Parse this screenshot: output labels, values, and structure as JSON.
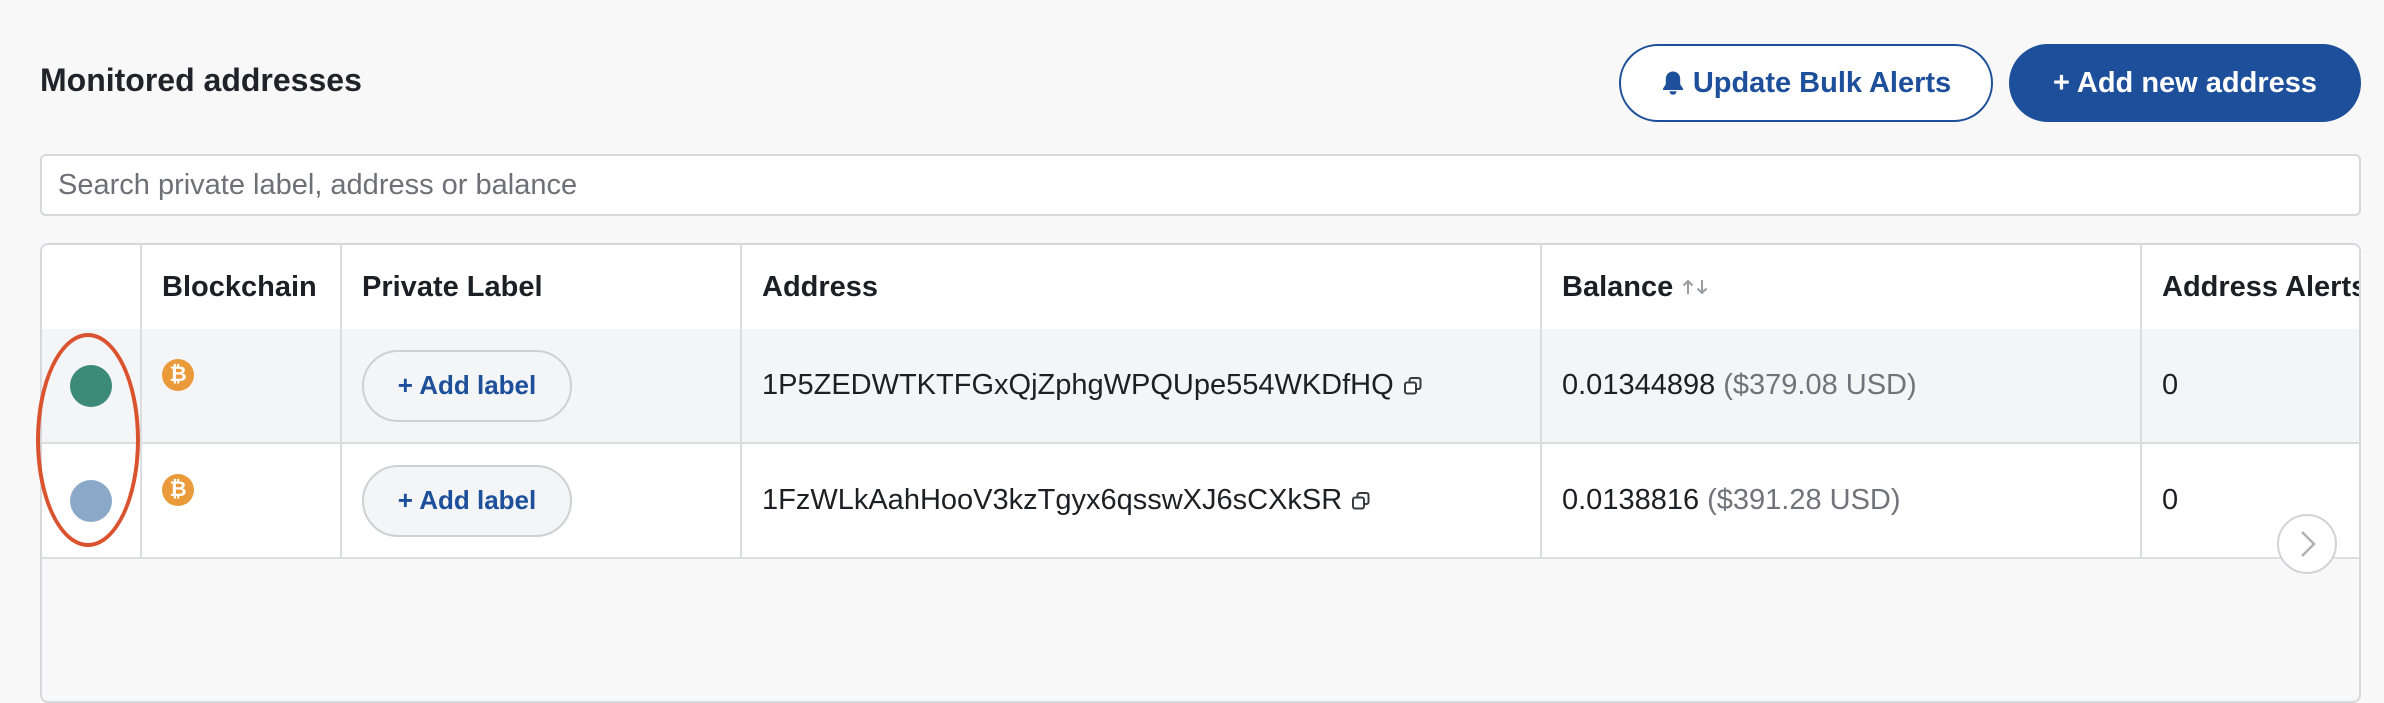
{
  "page": {
    "title": "Monitored addresses",
    "update_alerts_label": "Update Bulk Alerts",
    "add_address_label": "+ Add new address",
    "search_placeholder": "Search private label, address or balance"
  },
  "colors": {
    "accent": "#1d4f9a",
    "bitcoin": "#eb9a3a",
    "annotation": "#d9532f"
  },
  "icons": {
    "bell": "bell-icon",
    "bitcoin": "bitcoin-icon",
    "copy": "copy-icon",
    "sort": "sort-icon",
    "scroll": "chevron-right-icon"
  },
  "table": {
    "columns": [
      "",
      "Blockchain",
      "Private Label",
      "Address",
      "Balance",
      "Address Alerts"
    ],
    "rows": [
      {
        "status_color": "#3c8a78",
        "blockchain_icon": "bitcoin-icon",
        "label_button": "+ Add label",
        "address": "1P5ZEDWTKTFGxQjZphgWPQUpe554WKDfHQ",
        "balance": "0.01344898",
        "balance_usd": "($379.08 USD)",
        "alerts": "0"
      },
      {
        "status_color": "#8aa9c9",
        "blockchain_icon": "bitcoin-icon",
        "label_button": "+ Add label",
        "address": "1FzWLkAahHooV3kzTgyx6qsswXJ6sCXkSR",
        "balance": "0.0138816",
        "balance_usd": "($391.28 USD)",
        "alerts": "0"
      }
    ]
  }
}
